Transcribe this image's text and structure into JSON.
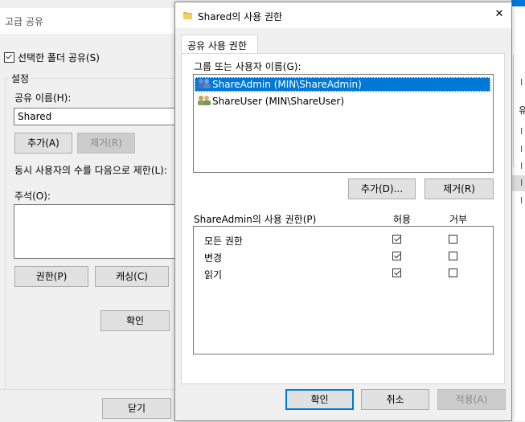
{
  "bg_window": {
    "title": "고급 공유",
    "share_checkbox_label": "선택한 폴더 공유(S)",
    "settings_group": "설정",
    "share_name_label": "공유 이름(H):",
    "share_name_value": "Shared",
    "add_button": "추가(A)",
    "remove_button": "제거(R)",
    "limit_label": "동시 사용자의 수를 다음으로 제한(L):",
    "comment_label": "주석(O):",
    "permissions_button": "권한(P)",
    "caching_button": "캐싱(C)",
    "ok_button": "확인",
    "close_button": "닫기"
  },
  "dialog": {
    "title": "Shared의 사용 권한",
    "close_glyph": "✕",
    "tab": "공유 사용 권한",
    "group_label": "그룹 또는 사용자 이름(G):",
    "users": [
      {
        "name": "ShareAdmin (MIN\\ShareAdmin)",
        "selected": true
      },
      {
        "name": "ShareUser (MIN\\ShareUser)",
        "selected": false
      }
    ],
    "add_button": "추가(D)...",
    "remove_button": "제거(R)",
    "perm_label": "ShareAdmin의 사용 권한(P)",
    "allow_header": "허용",
    "deny_header": "거부",
    "permissions": [
      {
        "name": "모든 권한",
        "allow": true,
        "deny": false
      },
      {
        "name": "변경",
        "allow": true,
        "deny": false
      },
      {
        "name": "읽기",
        "allow": true,
        "deny": false
      }
    ],
    "ok_button": "확인",
    "cancel_button": "취소",
    "apply_button": "적용(A)"
  },
  "right_window": {
    "fragments": [
      "유",
      "I",
      "I",
      "I",
      "I",
      "I",
      "I"
    ]
  },
  "colors": {
    "selection": "#0078d7",
    "accent_bar": "#0078d7"
  }
}
